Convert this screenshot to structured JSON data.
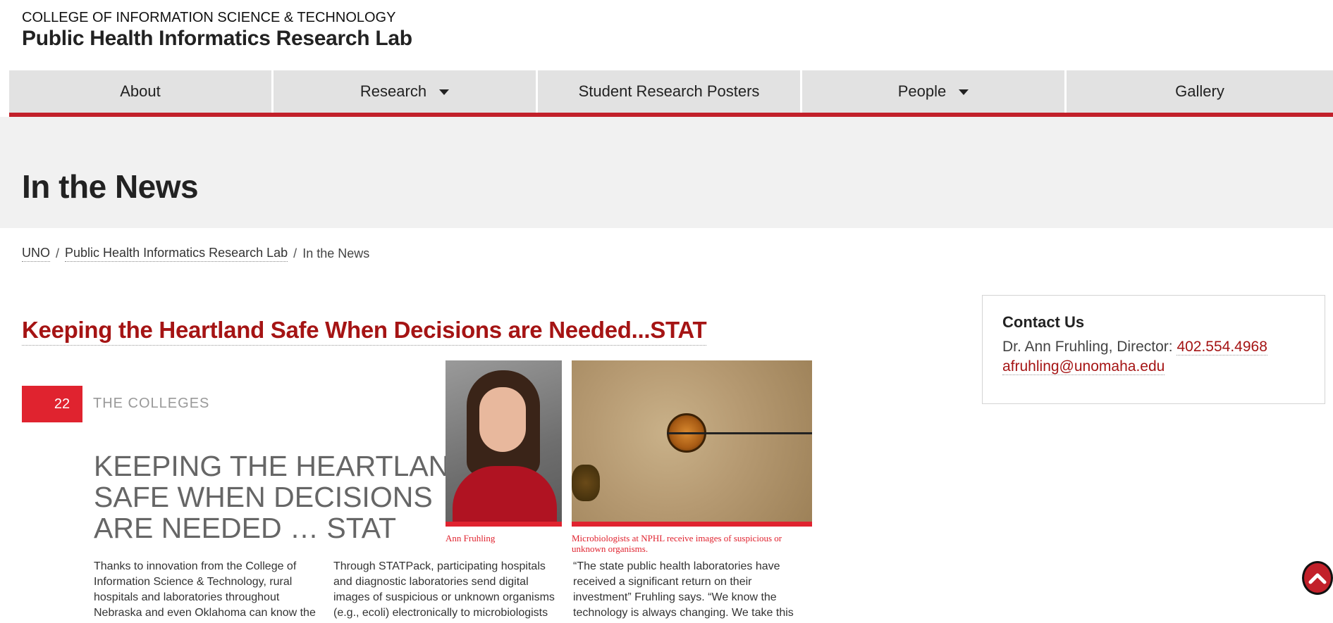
{
  "header": {
    "college": "COLLEGE OF INFORMATION SCIENCE & TECHNOLOGY",
    "lab": "Public Health Informatics Research Lab"
  },
  "nav": {
    "items": [
      {
        "label": "About",
        "has_dropdown": false
      },
      {
        "label": "Research",
        "has_dropdown": true
      },
      {
        "label": "Student Research Posters",
        "has_dropdown": false
      },
      {
        "label": "People",
        "has_dropdown": true
      },
      {
        "label": "Gallery",
        "has_dropdown": false
      }
    ]
  },
  "page": {
    "title": "In the News"
  },
  "breadcrumb": {
    "items": [
      "UNO",
      "Public Health Informatics Research Lab",
      "In the News"
    ]
  },
  "article": {
    "title": "Keeping the Heartland Safe When Decisions are Needed...STAT",
    "image": {
      "page_number": "22",
      "section": "THE COLLEGES",
      "headline_lines": [
        "KEEPING THE HEARTLAND",
        "SAFE WHEN DECISIONS",
        "ARE NEEDED … STAT"
      ],
      "caption_person": "Ann Fruhling",
      "caption_micro": "Microbiologists at NPHL receive images of suspicious or unknown organisms.",
      "col1": "Thanks to innovation from the College of Information Science & Technology, rural hospitals and laboratories throughout Nebraska and even Oklahoma can know the",
      "col2": "Through STATPack, participating hospitals and diagnostic laboratories send digital images of suspicious or unknown organisms (e.g., ecoli) electronically to microbiologists",
      "col3": "“The state public health laboratories have received a significant return on their investment” Fruhling says. “We know the technology is always changing. We take this"
    }
  },
  "contact": {
    "heading": "Contact Us",
    "name": "Dr. Ann Fruhling, Director: ",
    "phone": "402.554.4968",
    "email": "afruhling@unomaha.edu"
  },
  "colors": {
    "accent_red": "#c2202a",
    "link_red": "#a51414",
    "nav_bg": "#e2e2e2",
    "banner_bg": "#f1f1f1"
  },
  "icons": {
    "dropdown": "caret-down-icon",
    "back_to_top": "chevron-up-icon"
  }
}
